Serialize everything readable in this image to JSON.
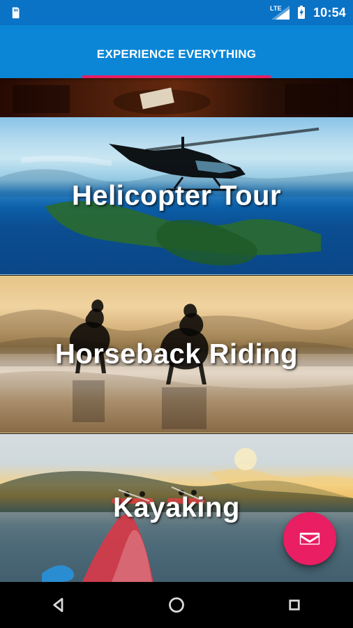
{
  "status_bar": {
    "network_label": "LTE",
    "time": "10:54"
  },
  "app_bar": {
    "title": "EXPERIENCE EVERYTHING"
  },
  "cards": [
    {
      "name": "card-top",
      "label": ""
    },
    {
      "name": "card-helicopter-tour",
      "label": "Helicopter Tour"
    },
    {
      "name": "card-horseback-riding",
      "label": "Horseback Riding"
    },
    {
      "name": "card-kayaking",
      "label": "Kayaking"
    }
  ],
  "colors": {
    "primary": "#0b86d6",
    "primary_dark": "#0b73c6",
    "accent": "#e91e63"
  },
  "fab": {
    "icon": "envelope-icon"
  },
  "navigation_bar": {
    "back_icon": "back-triangle-icon",
    "home_icon": "home-circle-icon",
    "recents_icon": "recents-square-icon"
  }
}
